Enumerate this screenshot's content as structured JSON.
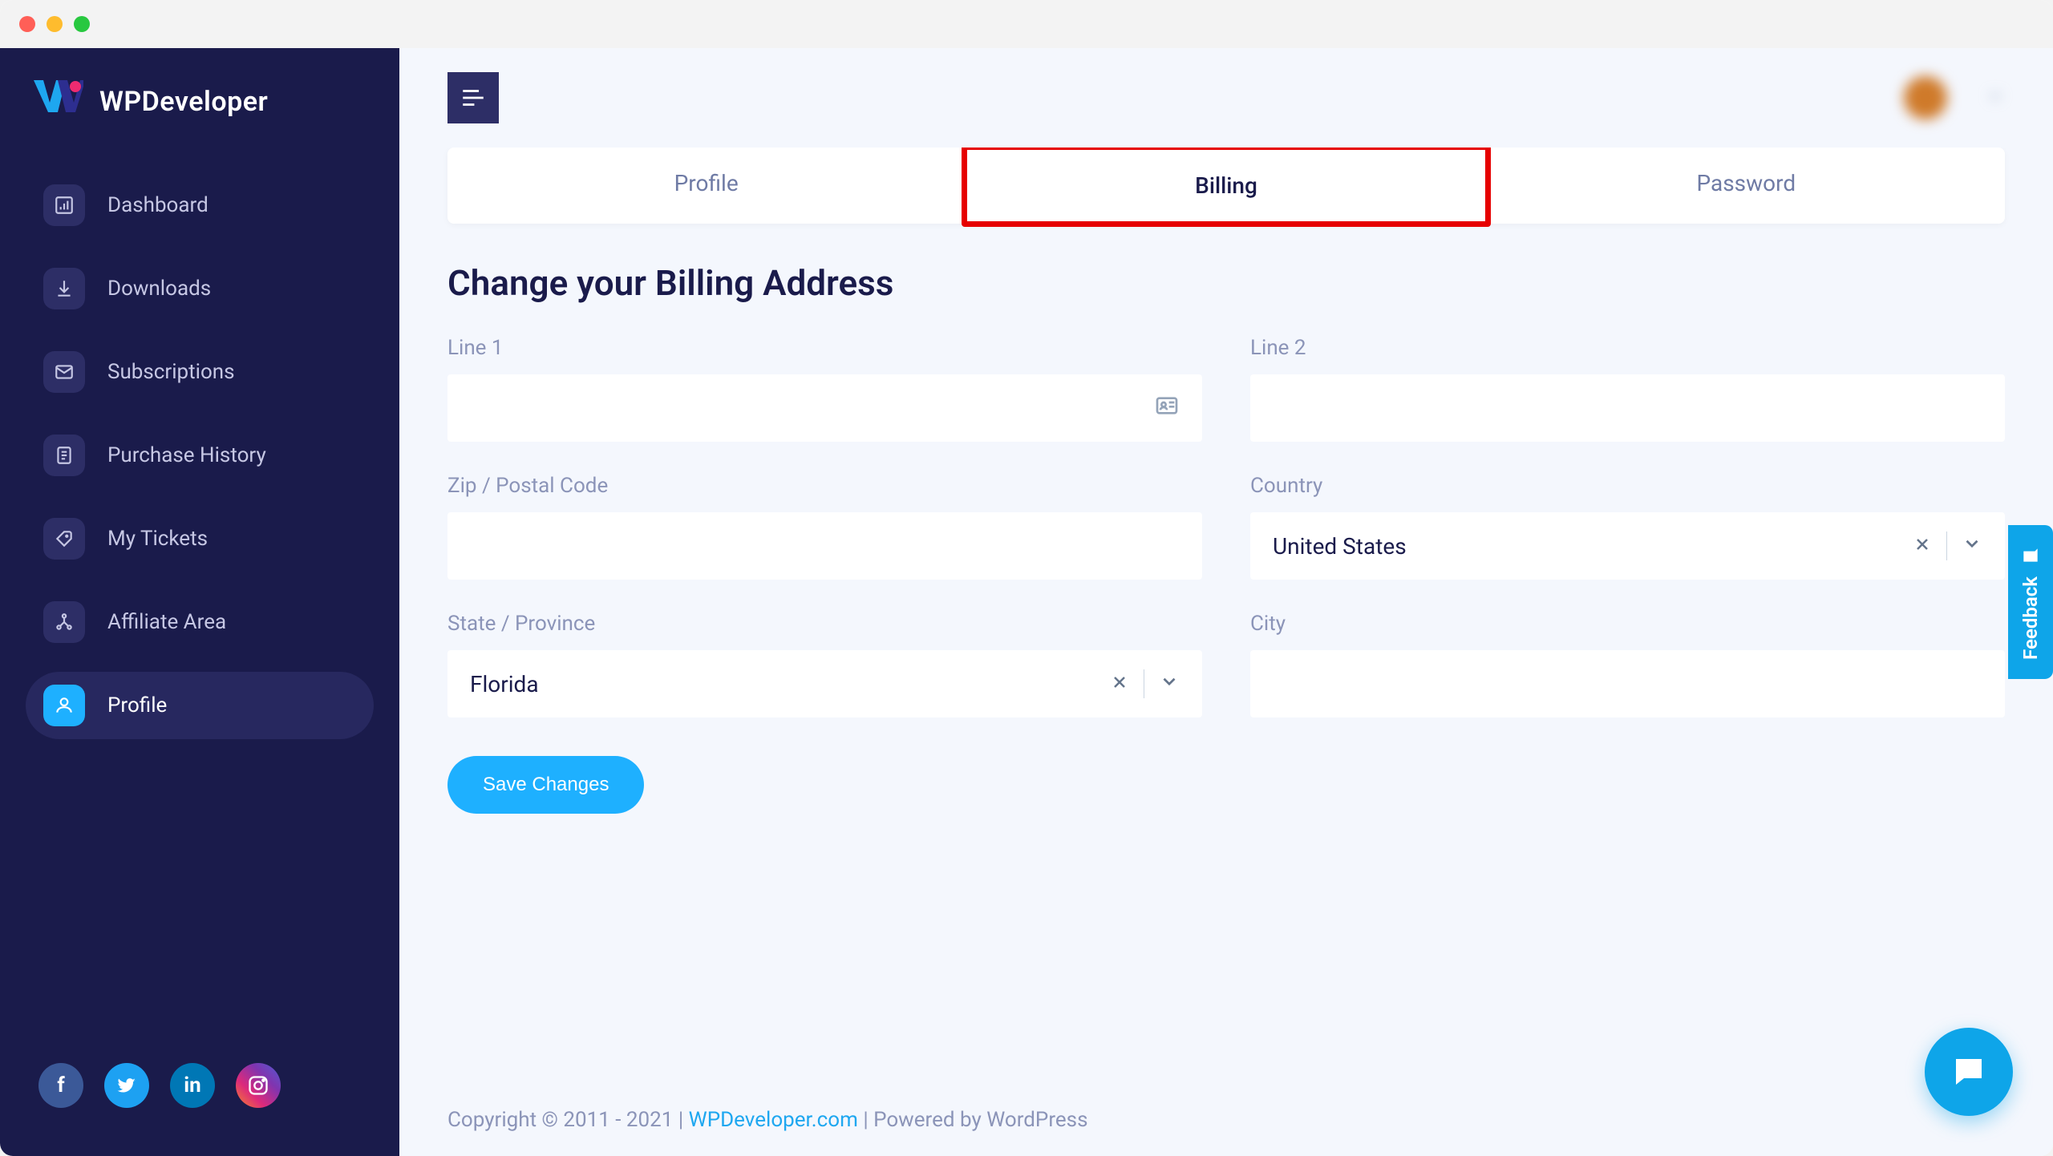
{
  "brand": "WPDeveloper",
  "sidebar": {
    "items": [
      {
        "label": "Dashboard",
        "icon": "chart-icon"
      },
      {
        "label": "Downloads",
        "icon": "download-icon"
      },
      {
        "label": "Subscriptions",
        "icon": "mail-icon"
      },
      {
        "label": "Purchase History",
        "icon": "receipt-icon"
      },
      {
        "label": "My Tickets",
        "icon": "tag-icon"
      },
      {
        "label": "Affiliate Area",
        "icon": "network-icon"
      },
      {
        "label": "Profile",
        "icon": "user-icon"
      }
    ]
  },
  "tabs": {
    "profile": "Profile",
    "billing": "Billing",
    "password": "Password"
  },
  "heading": "Change your Billing Address",
  "form": {
    "line1_label": "Line 1",
    "line2_label": "Line 2",
    "zip_label": "Zip / Postal Code",
    "country_label": "Country",
    "country_value": "United States",
    "state_label": "State / Province",
    "state_value": "Florida",
    "city_label": "City",
    "save_label": "Save Changes"
  },
  "footer": {
    "prefix": "Copyright © 2011 - 2021 | ",
    "link": "WPDeveloper.com",
    "suffix": " | Powered by WordPress"
  },
  "feedback": "Feedback",
  "user": {
    "name": ""
  }
}
